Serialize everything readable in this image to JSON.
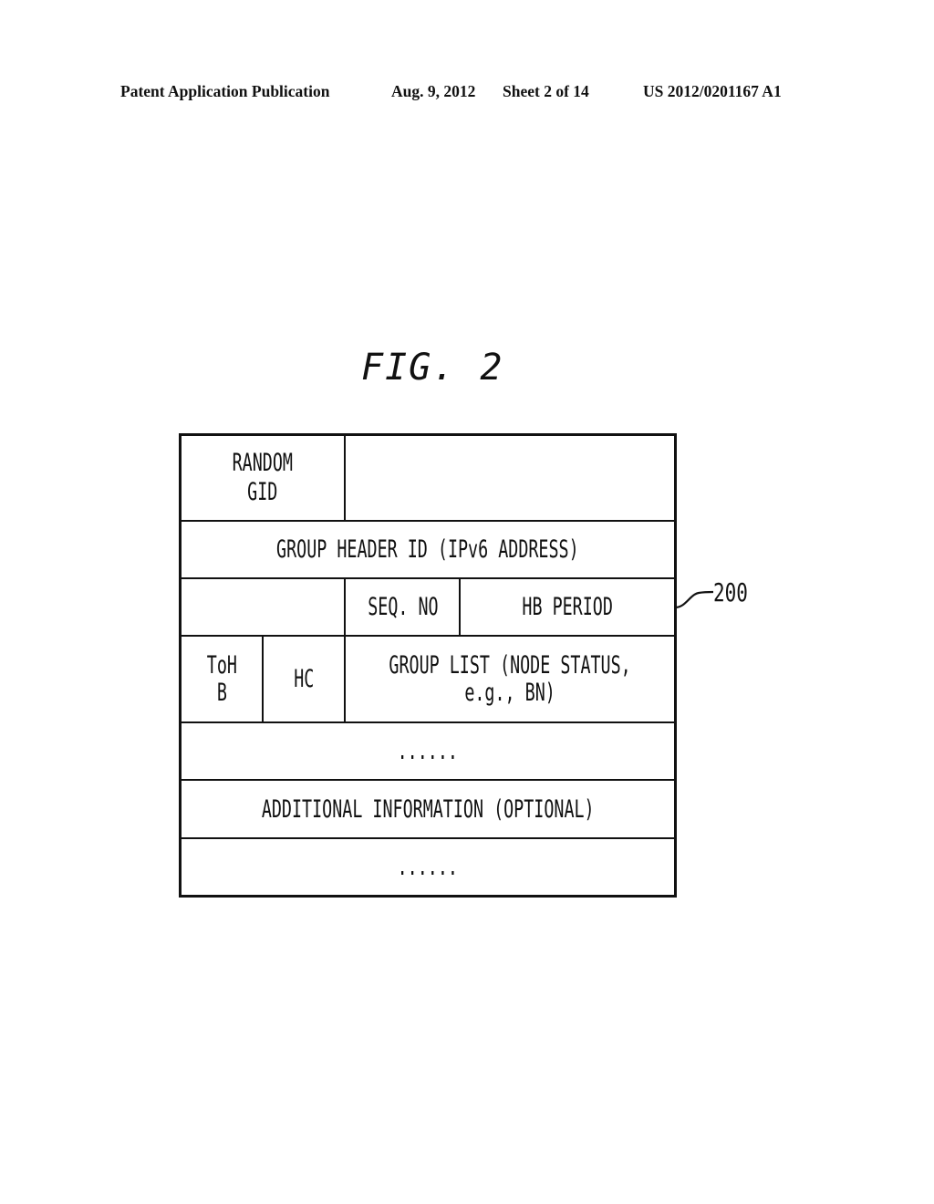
{
  "header": {
    "publication": "Patent Application Publication",
    "date": "Aug. 9, 2012",
    "sheet": "Sheet 2 of 14",
    "number": "US 2012/0201167 A1"
  },
  "figure": {
    "title": "FIG. 2",
    "reference_label": "200"
  },
  "table": {
    "rows": [
      {
        "cells": [
          "RANDOM\nGID",
          ""
        ]
      },
      {
        "cells": [
          "GROUP HEADER ID (IPv6 ADDRESS)"
        ]
      },
      {
        "cells": [
          "",
          "SEQ. NO",
          "HB PERIOD"
        ]
      },
      {
        "cells": [
          "ToH\nB",
          "HC",
          "GROUP LIST (NODE STATUS,\ne.g., BN)"
        ]
      },
      {
        "cells": [
          "......"
        ]
      },
      {
        "cells": [
          "ADDITIONAL INFORMATION (OPTIONAL)"
        ]
      },
      {
        "cells": [
          "......"
        ]
      }
    ]
  }
}
